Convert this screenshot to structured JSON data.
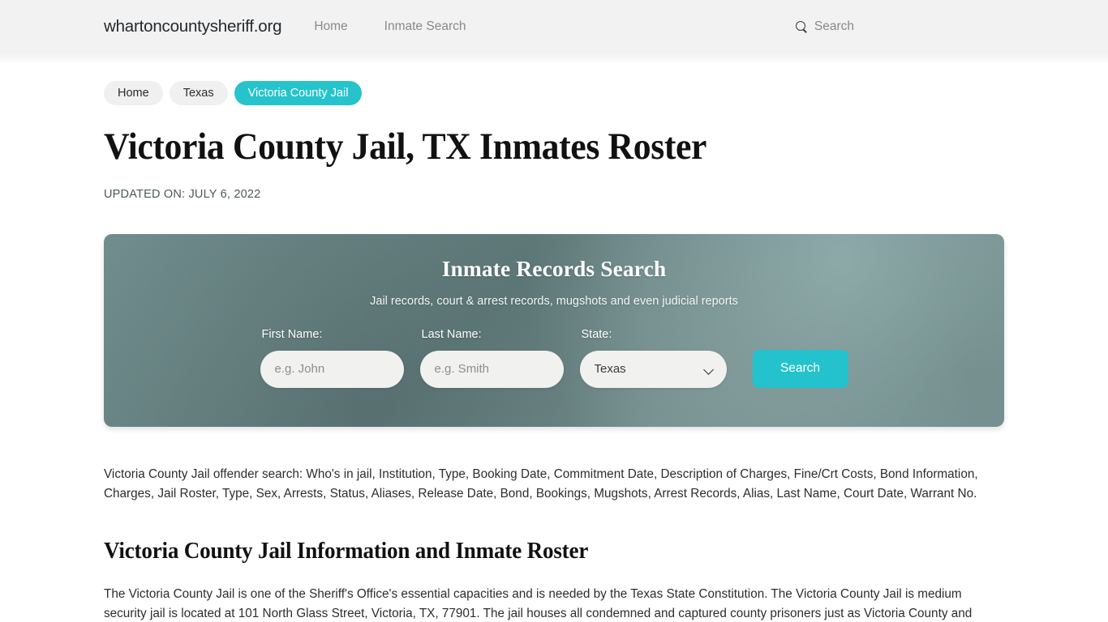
{
  "header": {
    "brand": "whartoncountysheriff.org",
    "nav": [
      {
        "label": "Home"
      },
      {
        "label": "Inmate Search"
      }
    ],
    "search": {
      "icon": "search-icon",
      "label": "Search"
    }
  },
  "breadcrumb": [
    {
      "label": "Home",
      "active": false
    },
    {
      "label": "Texas",
      "active": false
    },
    {
      "label": "Victoria County Jail",
      "active": true
    }
  ],
  "main": {
    "title": "Victoria County Jail, TX Inmates Roster",
    "updated_on": "UPDATED ON: JULY 6, 2022",
    "intro_paragraph": "Victoria County Jail offender search: Who's in jail, Institution, Type, Booking Date, Commitment Date, Description of Charges, Fine/Crt Costs, Bond Information, Charges, Jail Roster, Type, Sex, Arrests, Status, Aliases, Release Date, Bond, Bookings, Mugshots, Arrest Records, Alias, Last Name, Court Date, Warrant No.",
    "section_heading": "Victoria County Jail Information and Inmate Roster",
    "body_paragraph": "The Victoria County Jail is one of the Sheriff's Office's essential capacities and is needed by the Texas State Constitution. The Victoria County Jail is medium security jail is located at 101 North Glass Street, Victoria, TX, 77901. The jail houses all condemned and captured county prisoners just as Victoria County and"
  },
  "search_panel": {
    "title": "Inmate Records Search",
    "subtitle": "Jail records, court & arrest records, mugshots and even judicial reports",
    "first_name": {
      "label": "First Name:",
      "placeholder": "e.g. John",
      "value": ""
    },
    "last_name": {
      "label": "Last Name:",
      "placeholder": "e.g. Smith",
      "value": ""
    },
    "state": {
      "label": "State:",
      "selected": "Texas"
    },
    "submit_label": "Search"
  },
  "colors": {
    "accent_teal": "#26c3cd",
    "button_teal": "#23c2cc",
    "header_bg": "#f2f2f2",
    "pill_bg": "#f0f0f0",
    "panel_bg": "#5e7878",
    "input_bg": "#f1f1ef"
  }
}
